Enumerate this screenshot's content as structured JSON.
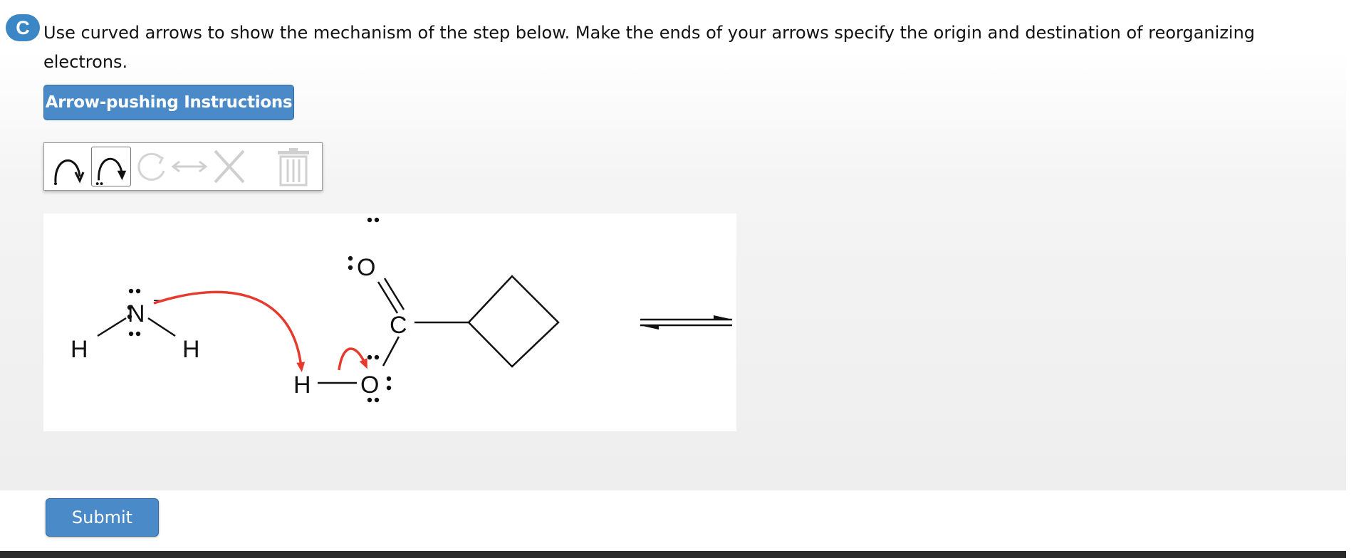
{
  "question": {
    "part_label": "C",
    "text": "Use curved arrows to show the mechanism of the step below. Make the ends of your arrows specify the origin and destination of reorganizing electrons."
  },
  "instructions_button": "Arrow-pushing Instructions",
  "toolbar": {
    "tools": [
      {
        "name": "single-electron-arrow-icon",
        "state": "enabled"
      },
      {
        "name": "electron-pair-arrow-icon",
        "state": "selected"
      },
      {
        "name": "redo-icon",
        "state": "disabled"
      },
      {
        "name": "double-headed-arrow-icon",
        "state": "disabled"
      },
      {
        "name": "delete-x-icon",
        "state": "disabled"
      },
      {
        "name": "trash-icon",
        "state": "disabled"
      }
    ]
  },
  "molecule": {
    "ammonia": {
      "N": "N",
      "H_left": "H",
      "H_right": "H",
      "charge": "–"
    },
    "acid": {
      "O_carbonyl": "O",
      "C": "C",
      "O_hydroxyl": "O",
      "H": "H"
    },
    "arrow_color": "#e63a2f"
  },
  "submit_button": "Submit",
  "colors": {
    "accent": "#4a8ac8",
    "badge": "#3b87c6",
    "arrow": "#e63a2f"
  }
}
